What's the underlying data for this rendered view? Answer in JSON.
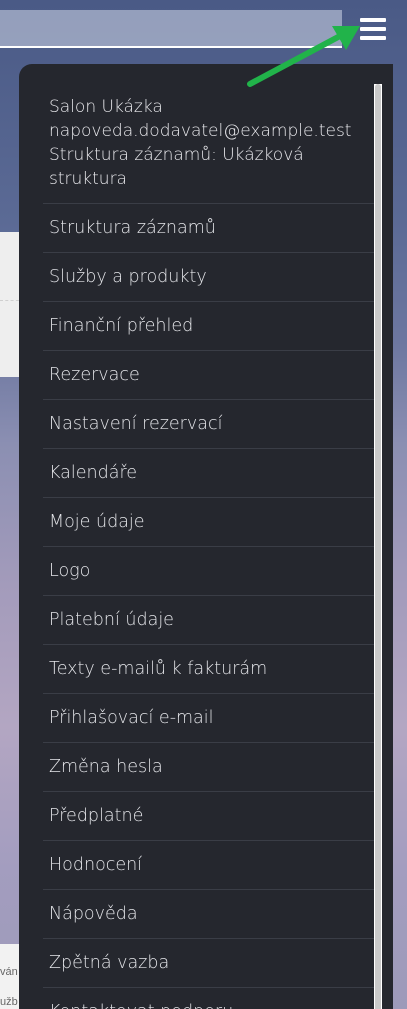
{
  "background": {
    "overflow_text": "struktura",
    "footer_lines": [
      "ván",
      "užb"
    ]
  },
  "menu": {
    "header": {
      "salon": "Salon Ukázka",
      "email": "napoveda.dodavatel@example.test",
      "structure_line1": "Struktura záznamů: Ukázková",
      "structure_line2": "struktura"
    },
    "items": [
      {
        "label": "Struktura záznamů"
      },
      {
        "label": "Služby a produkty"
      },
      {
        "label": "Finanční přehled"
      },
      {
        "label": "Rezervace"
      },
      {
        "label": "Nastavení rezervací"
      },
      {
        "label": "Kalendáře"
      },
      {
        "label": "Moje údaje"
      },
      {
        "label": "Logo"
      },
      {
        "label": "Platební údaje"
      },
      {
        "label": "Texty e-mailů k fakturám"
      },
      {
        "label": "Přihlašovací e-mail"
      },
      {
        "label": "Změna hesla"
      },
      {
        "label": "Předplatné"
      },
      {
        "label": "Hodnocení"
      },
      {
        "label": "Nápověda"
      },
      {
        "label": "Zpětná vazba"
      },
      {
        "label": "Kontaktovat podporu"
      }
    ]
  },
  "icons": {
    "menu_toggle": "hamburger-icon",
    "annotation": "arrow-icon"
  },
  "colors": {
    "menu_bg": "#25272e",
    "annotation_arrow": "#21b34a",
    "menu_text": "#e3e4e8"
  }
}
